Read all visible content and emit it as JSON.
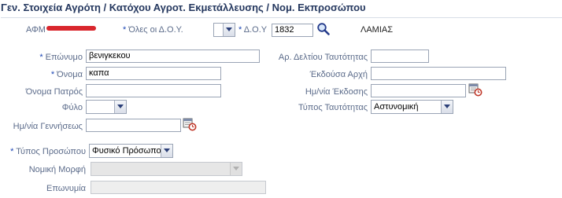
{
  "header": {
    "title": "Γεν. Στοιχεία Αγρότη / Κατόχου Αγροτ. Εκμετάλλευσης / Νομ. Εκπροσώπου"
  },
  "afm": {
    "label": "ΑΦΜ"
  },
  "doy_all": {
    "label": "Όλες οι Δ.Ο.Υ.",
    "value": ""
  },
  "doy": {
    "label": "Δ.Ο.Υ",
    "value": "1832",
    "name": "ΛΑΜΙΑΣ"
  },
  "fields": {
    "surname": {
      "label": "Επώνυμο",
      "value": "βενιγκεκου"
    },
    "first_name": {
      "label": "Όνομα",
      "value": "καπα"
    },
    "father_name": {
      "label": "Όνομα Πατρός",
      "value": ""
    },
    "gender": {
      "label": "Φύλο",
      "value": ""
    },
    "birth_date": {
      "label": "Ημ/νία Γεννήσεως",
      "value": ""
    },
    "id_number": {
      "label": "Αρ. Δελτίου Ταυτότητας",
      "value": ""
    },
    "issuing_authority": {
      "label": "Έκδούσα Αρχή",
      "value": ""
    },
    "issue_date": {
      "label": "Ημ/νία Έκδοσης",
      "value": ""
    },
    "id_type": {
      "label": "Τύπος Ταυτότητας",
      "value": "Αστυνομική"
    },
    "person_type": {
      "label": "Τύπος Προσώπου",
      "value": "Φυσικό Πρόσωπο"
    },
    "legal_form": {
      "label": "Νομική Μορφή",
      "value": ""
    },
    "company_name": {
      "label": "Επωνυμία",
      "value": ""
    }
  },
  "required_marker": "*",
  "icons": {
    "search": "search-icon",
    "calendar": "calendar-icon"
  },
  "colors": {
    "title": "#25385f",
    "label": "#5b6b8a",
    "required": "#1c46b5",
    "redaction": "#d9262d"
  }
}
